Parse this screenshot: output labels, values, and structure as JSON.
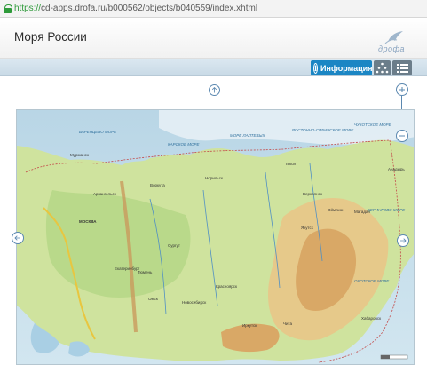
{
  "browser": {
    "url_protocol": "https://",
    "url_rest": "cd-apps.drofa.ru/b000562/objects/b040559/index.xhtml"
  },
  "header": {
    "title": "Моря России",
    "logo_text": "дрофа"
  },
  "toolbar": {
    "info_label": "Информация"
  },
  "map": {
    "city_labels": [
      "МОСКВА",
      "Архангельск",
      "Воркута",
      "Якутск",
      "Омск",
      "Новосибирск",
      "Красноярск",
      "Иркутск",
      "Чита",
      "Хабаровск",
      "Магадан",
      "Анадырь",
      "Мурманск",
      "Норильск",
      "Тикси",
      "Верхоянск",
      "Оймякон",
      "Сургут",
      "Тюмень",
      "Екатеринбург"
    ],
    "sea_labels": [
      "КАРСКОЕ МОРЕ",
      "МОРЕ ЛАПТЕВЫХ",
      "ВОСТОЧНО-СИБИРСКОЕ МОРЕ",
      "ЧУКОТСКОЕ МОРЕ",
      "БАРЕНЦЕВО МОРЕ",
      "ОХОТСКОЕ МОРЕ",
      "БЕРИНГОВО МОРЕ"
    ]
  }
}
